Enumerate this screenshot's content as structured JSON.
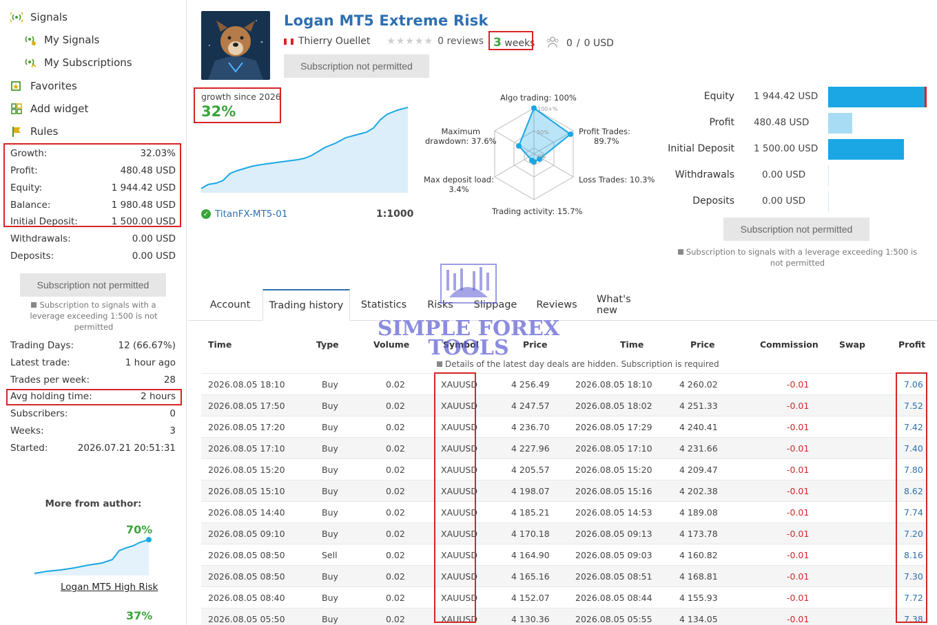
{
  "sidebar": {
    "nav": [
      {
        "label": "Signals",
        "icon": "signal-antenna-icon"
      },
      {
        "label": "My Signals",
        "icon": "my-signals-icon"
      },
      {
        "label": "My Subscriptions",
        "icon": "subscriptions-icon"
      },
      {
        "label": "Favorites",
        "icon": "favorites-icon"
      },
      {
        "label": "Add widget",
        "icon": "widget-icon"
      },
      {
        "label": "Rules",
        "icon": "flag-icon"
      }
    ],
    "stats": [
      {
        "label": "Growth:",
        "value": "32.03%"
      },
      {
        "label": "Profit:",
        "value": "480.48 USD"
      },
      {
        "label": "Equity:",
        "value": "1 944.42 USD"
      },
      {
        "label": "Balance:",
        "value": "1 980.48 USD"
      },
      {
        "label": "Initial Deposit:",
        "value": "1 500.00 USD"
      },
      {
        "label": "Withdrawals:",
        "value": "0.00 USD"
      },
      {
        "label": "Deposits:",
        "value": "0.00 USD"
      }
    ],
    "subscribe_button": "Subscription not permitted",
    "subscribe_note": "Subscription to signals with a leverage exceeding 1:500 is not permitted",
    "trading": [
      {
        "label": "Trading Days:",
        "value": "12 (66.67%)"
      },
      {
        "label": "Latest trade:",
        "value": "1 hour ago"
      },
      {
        "label": "Trades per week:",
        "value": "28"
      },
      {
        "label": "Avg holding time:",
        "value": "2 hours"
      },
      {
        "label": "Subscribers:",
        "value": "0"
      },
      {
        "label": "Weeks:",
        "value": "3"
      },
      {
        "label": "Started:",
        "value": "2026.07.21 20:51:31"
      }
    ],
    "more_from_author": {
      "title": "More from author:",
      "items": [
        {
          "growth": "70%",
          "name": "Logan MT5 High Risk"
        },
        {
          "growth": "37%",
          "name": ""
        }
      ]
    }
  },
  "header": {
    "title": "Logan MT5 Extreme Risk",
    "author": "Thierry Ouellet",
    "reviews": "0 reviews",
    "weeks_number": "3",
    "weeks_unit": "weeks",
    "subscribers": "0",
    "funds": "0 USD",
    "subscribe_button": "Subscription not permitted"
  },
  "growth": {
    "label": "growth since 2026",
    "value": "32%",
    "broker": "TitanFX-MT5-01",
    "leverage": "1:1000"
  },
  "radar": {
    "algo": "Algo trading: 100%",
    "profit_trades_1": "Profit Trades:",
    "profit_trades_2": "89.7%",
    "loss_trades": "Loss Trades: 10.3%",
    "activity": "Trading activity: 15.7%",
    "load_1": "Max deposit load:",
    "load_2": "3.4%",
    "drawdown_1": "Maximum",
    "drawdown_2": "drawdown: 37.6%",
    "tick_100": "100+%",
    "tick_50": "50%",
    "tick_0": "0%"
  },
  "balance": {
    "rows": [
      {
        "label": "Equity",
        "value": "1 944.42 USD",
        "fraction": 1.0,
        "color": "#1aa7e4"
      },
      {
        "label": "Profit",
        "value": "480.48 USD",
        "fraction": 0.247,
        "color": "#a8dcf5"
      },
      {
        "label": "Initial Deposit",
        "value": "1 500.00 USD",
        "fraction": 0.771,
        "color": "#1aa7e4"
      },
      {
        "label": "Withdrawals",
        "value": "0.00 USD",
        "fraction": 0,
        "color": "#1aa7e4"
      },
      {
        "label": "Deposits",
        "value": "0.00 USD",
        "fraction": 0,
        "color": "#1aa7e4"
      }
    ],
    "subscribe_button": "Subscription not permitted",
    "note": "Subscription to signals with a leverage exceeding 1:500 is not permitted"
  },
  "tabs": [
    "Account",
    "Trading history",
    "Statistics",
    "Risks",
    "Slippage",
    "Reviews",
    "What's new"
  ],
  "watermark": {
    "line1": "SIMPLE FOREX",
    "line2": "TOOLS"
  },
  "table": {
    "headers": [
      "Time",
      "Type",
      "Volume",
      "Symbol",
      "Price",
      "Time",
      "Price",
      "Commission",
      "Swap",
      "Profit"
    ],
    "hidden_note": "Details of the latest day deals are hidden. Subscription is required",
    "rows": [
      [
        "2026.08.05 18:10",
        "Buy",
        "0.02",
        "XAUUSD",
        "4 256.49",
        "2026.08.05 18:10",
        "4 260.02",
        "-0.01",
        "",
        "7.06"
      ],
      [
        "2026.08.05 17:50",
        "Buy",
        "0.02",
        "XAUUSD",
        "4 247.57",
        "2026.08.05 18:02",
        "4 251.33",
        "-0.01",
        "",
        "7.52"
      ],
      [
        "2026.08.05 17:20",
        "Buy",
        "0.02",
        "XAUUSD",
        "4 236.70",
        "2026.08.05 17:29",
        "4 240.41",
        "-0.01",
        "",
        "7.42"
      ],
      [
        "2026.08.05 17:10",
        "Buy",
        "0.02",
        "XAUUSD",
        "4 227.96",
        "2026.08.05 17:10",
        "4 231.66",
        "-0.01",
        "",
        "7.40"
      ],
      [
        "2026.08.05 15:20",
        "Buy",
        "0.02",
        "XAUUSD",
        "4 205.57",
        "2026.08.05 15:20",
        "4 209.47",
        "-0.01",
        "",
        "7.80"
      ],
      [
        "2026.08.05 15:10",
        "Buy",
        "0.02",
        "XAUUSD",
        "4 198.07",
        "2026.08.05 15:16",
        "4 202.38",
        "-0.01",
        "",
        "8.62"
      ],
      [
        "2026.08.05 14:40",
        "Buy",
        "0.02",
        "XAUUSD",
        "4 185.21",
        "2026.08.05 14:53",
        "4 189.08",
        "-0.01",
        "",
        "7.74"
      ],
      [
        "2026.08.05 09:10",
        "Buy",
        "0.02",
        "XAUUSD",
        "4 170.18",
        "2026.08.05 09:13",
        "4 173.78",
        "-0.01",
        "",
        "7.20"
      ],
      [
        "2026.08.05 08:50",
        "Sell",
        "0.02",
        "XAUUSD",
        "4 164.90",
        "2026.08.05 09:03",
        "4 160.82",
        "-0.01",
        "",
        "8.16"
      ],
      [
        "2026.08.05 08:50",
        "Buy",
        "0.02",
        "XAUUSD",
        "4 165.16",
        "2026.08.05 08:51",
        "4 168.81",
        "-0.01",
        "",
        "7.30"
      ],
      [
        "2026.08.05 08:40",
        "Buy",
        "0.02",
        "XAUUSD",
        "4 152.07",
        "2026.08.05 08:44",
        "4 155.93",
        "-0.01",
        "",
        "7.72"
      ],
      [
        "2026.08.05 05:50",
        "Buy",
        "0.02",
        "XAUUSD",
        "4 130.36",
        "2026.08.05 05:55",
        "4 134.05",
        "-0.01",
        "",
        "7.38"
      ]
    ]
  },
  "colors": {
    "accent": "#2e6fb0",
    "green": "#39a539",
    "red_highlight": "#d52424",
    "chart_fill": "#dceefa",
    "chart_line": "#1aa7e4"
  }
}
